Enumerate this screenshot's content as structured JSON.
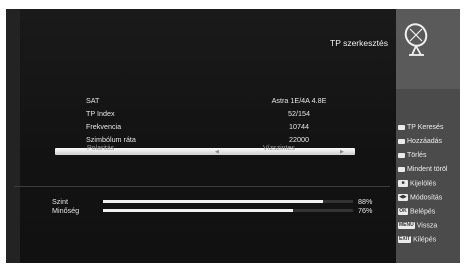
{
  "header": {
    "title": "TP szerkesztés"
  },
  "icons": {
    "satellite": "satellite-dish-icon"
  },
  "details": [
    {
      "label": "SAT",
      "value": "Astra 1E/4A 4.8E"
    },
    {
      "label": "TP Index",
      "value": "52/154"
    },
    {
      "label": "Frekvencia",
      "value": "10744"
    },
    {
      "label": "Szimbólum ráta",
      "value": "22000"
    }
  ],
  "selected": {
    "label": "Polaritás",
    "value": "Vízszintes"
  },
  "meters": {
    "level": {
      "label": "Szint",
      "value": "88%",
      "fraction": 0.88
    },
    "quality": {
      "label": "Minőség",
      "value": "76%",
      "fraction": 0.76
    }
  },
  "menu": [
    {
      "label": "TP Keresés",
      "key": ""
    },
    {
      "label": "Hozzáadás",
      "key": ""
    },
    {
      "label": "Törlés",
      "key": ""
    },
    {
      "label": "Mindent töröl",
      "key": ""
    },
    {
      "label": "Kijelölés",
      "key": "■"
    },
    {
      "label": "Módosítás",
      "key": "◀▶"
    },
    {
      "label": "Belépés",
      "key": "OK"
    },
    {
      "label": "Vissza",
      "key": "MENU"
    },
    {
      "label": "Kilépés",
      "key": "EXIT"
    }
  ],
  "colors": {
    "background": "#232323",
    "sidebar": "#4b4b4b",
    "accent": "#f2f2f2"
  }
}
